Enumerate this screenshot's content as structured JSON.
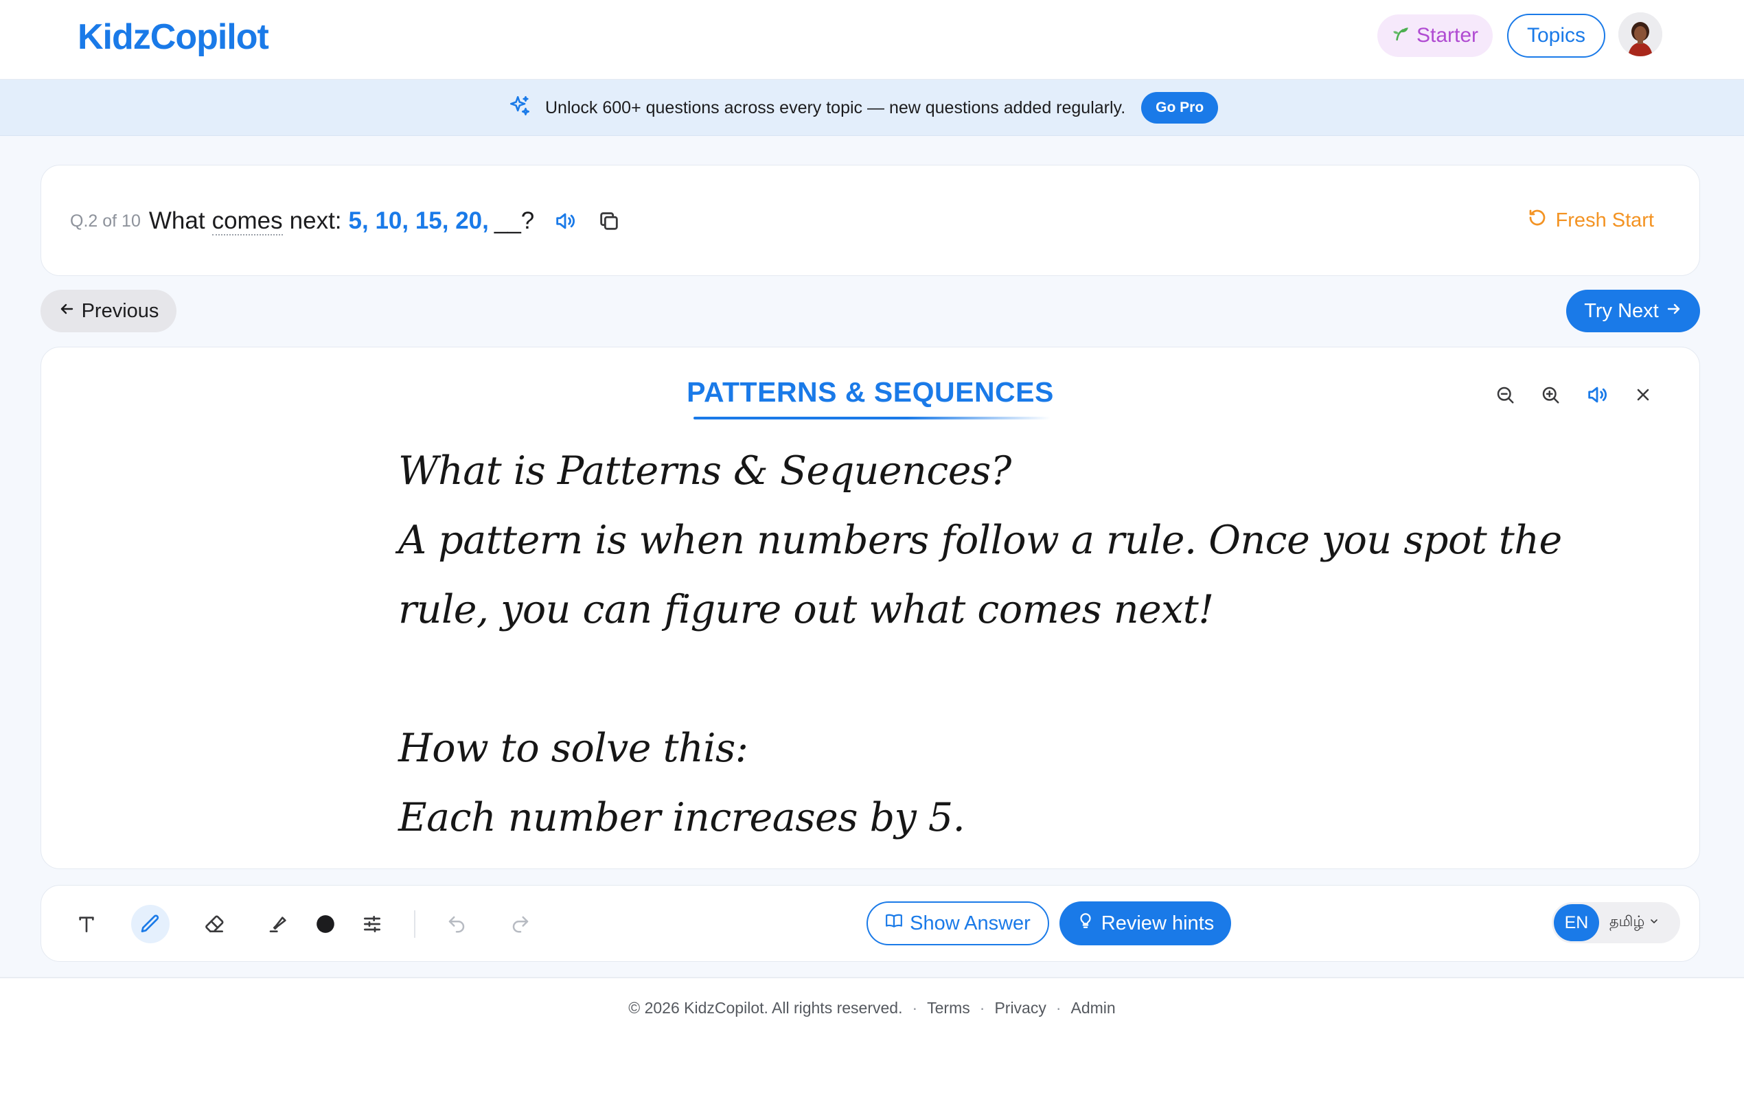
{
  "header": {
    "logo": "KidzCopilot",
    "plan_badge": "Starter",
    "topics_label": "Topics",
    "avatar_icon": "user-avatar"
  },
  "banner": {
    "icon": "sparkles-icon",
    "text": "Unlock 600+ questions across every topic — new questions added regularly.",
    "cta": "Go Pro"
  },
  "question": {
    "counter": "Q.2 of 10",
    "prefix": "What",
    "dotted_word": "comes",
    "suffix": "next:",
    "sequence": "5, 10, 15, 20,",
    "blank": "__?",
    "fresh_start": "Fresh Start"
  },
  "nav": {
    "previous": "Previous",
    "next": "Try Next"
  },
  "lesson": {
    "title": "PATTERNS & SEQUENCES",
    "lines": [
      "What is Patterns & Sequences?",
      "A pattern is when numbers follow a rule. Once you spot the",
      "rule, you can figure out what comes next!",
      "",
      "How to solve this:",
      "Each number increases by 5."
    ]
  },
  "toolbar": {
    "tools": [
      "text-tool",
      "pen-tool",
      "eraser-tool",
      "highlighter-tool",
      "color-picker",
      "settings-sliders",
      "undo",
      "redo"
    ],
    "show_answer": "Show Answer",
    "review_hints": "Review hints",
    "lang_en": "EN",
    "lang_ta": "தமிழ்",
    "ink_color": "#1c1c1e"
  },
  "footer": {
    "copyright": "© 2026 KidzCopilot. All rights reserved.",
    "links": [
      "Terms",
      "Privacy",
      "Admin"
    ],
    "separator": "·"
  },
  "colors": {
    "accent": "#1a7ae8",
    "orange": "#f39323",
    "purple": "#b04bd2"
  }
}
